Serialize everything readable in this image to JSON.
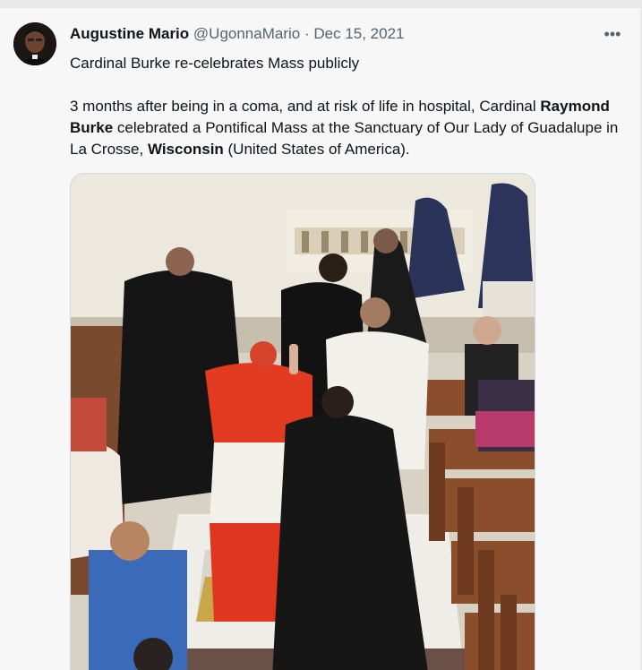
{
  "tweet": {
    "display_name": "Augustine Mario",
    "handle": "@UgonnaMario",
    "separator": "·",
    "date": "Dec 15, 2021",
    "more_label": "•••",
    "text_line1": "Cardinal Burke re-celebrates Mass publicly",
    "text_p2_part1": "3 months after being in a coma, and at risk of life in hospital, Cardinal ",
    "text_p2_bold1": "Raymond Burke",
    "text_p2_part2": " celebrated a Pontifical Mass at the Sanctuary of Our Lady of Guadalupe in La Crosse, ",
    "text_p2_bold2": "Wisconsin",
    "text_p2_part3": " (United States of America).",
    "media_icon": "photo-image"
  },
  "colors": {
    "name": "#0f1419",
    "muted": "#536471",
    "background": "#f7f7f7",
    "cardinal_red": "#e23b22"
  }
}
